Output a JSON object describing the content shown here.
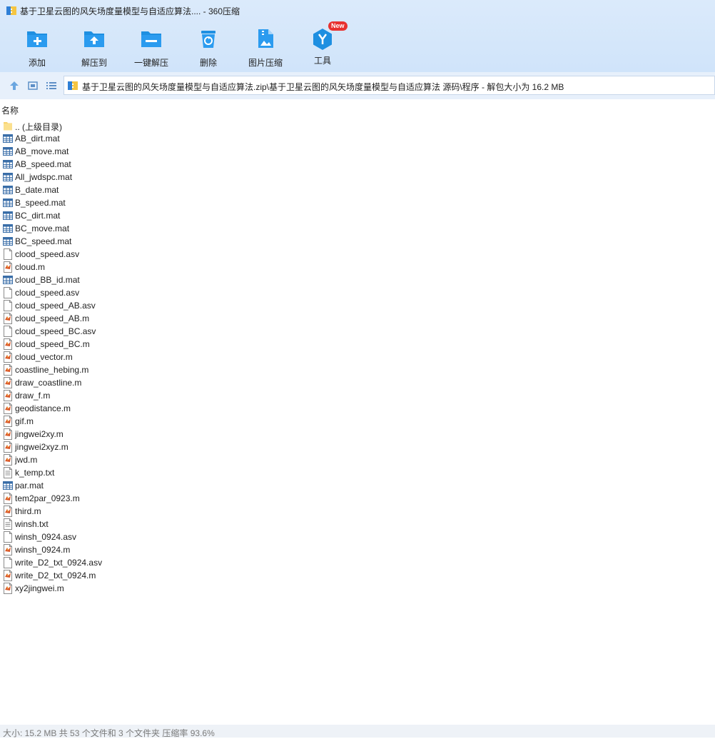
{
  "window": {
    "title": "基于卫星云图的风矢场度量模型与自适应算法.... - 360压缩"
  },
  "toolbar": {
    "add_label": "添加",
    "extract_to_label": "解压到",
    "one_click_extract_label": "一键解压",
    "delete_label": "删除",
    "image_compress_label": "图片压缩",
    "tools_label": "工具",
    "tools_badge": "New"
  },
  "address": {
    "path": "基于卫星云图的风矢场度量模型与自适应算法.zip\\基于卫星云图的风矢场度量模型与自适应算法 源码\\程序 - 解包大小为 16.2 MB"
  },
  "list": {
    "column_name": "名称",
    "files": [
      {
        "name": ".. (上级目录)",
        "icon": "folder-icon"
      },
      {
        "name": "AB_dirt.mat",
        "icon": "mat-file-icon"
      },
      {
        "name": "AB_move.mat",
        "icon": "mat-file-icon"
      },
      {
        "name": "AB_speed.mat",
        "icon": "mat-file-icon"
      },
      {
        "name": "All_jwdspc.mat",
        "icon": "mat-file-icon"
      },
      {
        "name": "B_date.mat",
        "icon": "mat-file-icon"
      },
      {
        "name": "B_speed.mat",
        "icon": "mat-file-icon"
      },
      {
        "name": "BC_dirt.mat",
        "icon": "mat-file-icon"
      },
      {
        "name": "BC_move.mat",
        "icon": "mat-file-icon"
      },
      {
        "name": "BC_speed.mat",
        "icon": "mat-file-icon"
      },
      {
        "name": "clood_speed.asv",
        "icon": "blank-file-icon"
      },
      {
        "name": "cloud.m",
        "icon": "matlab-file-icon"
      },
      {
        "name": "cloud_BB_id.mat",
        "icon": "mat-file-icon"
      },
      {
        "name": "cloud_speed.asv",
        "icon": "blank-file-icon"
      },
      {
        "name": "cloud_speed_AB.asv",
        "icon": "blank-file-icon"
      },
      {
        "name": "cloud_speed_AB.m",
        "icon": "matlab-file-icon"
      },
      {
        "name": "cloud_speed_BC.asv",
        "icon": "blank-file-icon"
      },
      {
        "name": "cloud_speed_BC.m",
        "icon": "matlab-file-icon"
      },
      {
        "name": "cloud_vector.m",
        "icon": "matlab-file-icon"
      },
      {
        "name": "coastline_hebing.m",
        "icon": "matlab-file-icon"
      },
      {
        "name": "draw_coastline.m",
        "icon": "matlab-file-icon"
      },
      {
        "name": "draw_f.m",
        "icon": "matlab-file-icon"
      },
      {
        "name": "geodistance.m",
        "icon": "matlab-file-icon"
      },
      {
        "name": "gif.m",
        "icon": "matlab-file-icon"
      },
      {
        "name": "jingwei2xy.m",
        "icon": "matlab-file-icon"
      },
      {
        "name": "jingwei2xyz.m",
        "icon": "matlab-file-icon"
      },
      {
        "name": "jwd.m",
        "icon": "matlab-file-icon"
      },
      {
        "name": "k_temp.txt",
        "icon": "text-file-icon"
      },
      {
        "name": "par.mat",
        "icon": "mat-file-icon"
      },
      {
        "name": "tem2par_0923.m",
        "icon": "matlab-file-icon"
      },
      {
        "name": "third.m",
        "icon": "matlab-file-icon"
      },
      {
        "name": "winsh.txt",
        "icon": "text-file-icon"
      },
      {
        "name": "winsh_0924.asv",
        "icon": "blank-file-icon"
      },
      {
        "name": "winsh_0924.m",
        "icon": "matlab-file-icon"
      },
      {
        "name": "write_D2_txt_0924.asv",
        "icon": "blank-file-icon"
      },
      {
        "name": "write_D2_txt_0924.m",
        "icon": "matlab-file-icon"
      },
      {
        "name": "xy2jingwei.m",
        "icon": "matlab-file-icon"
      }
    ]
  },
  "status": {
    "text": "大小: 15.2 MB 共 53 个文件和 3 个文件夹 压缩率 93.6%"
  },
  "colors": {
    "toolbar_bg": "#d0e4fa",
    "icon_blue": "#1e8fe1",
    "badge_red": "#e8312f"
  }
}
